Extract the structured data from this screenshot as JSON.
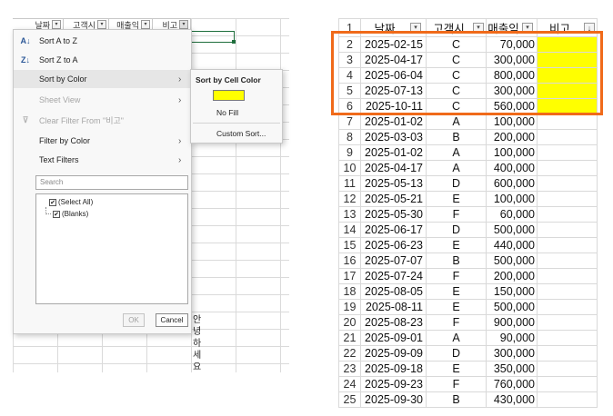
{
  "left_panel": {
    "headers": [
      {
        "label": "날짜",
        "active": false
      },
      {
        "label": "고객시",
        "active": false
      },
      {
        "label": "매출익",
        "active": false
      },
      {
        "label": "비고",
        "active": true
      }
    ],
    "filter_menu": {
      "items": [
        {
          "label": "Sort A to Z",
          "icon": "sort-az-icon",
          "enabled": true,
          "has_submenu": false
        },
        {
          "label": "Sort Z to A",
          "icon": "sort-za-icon",
          "enabled": true,
          "has_submenu": false
        },
        {
          "label": "Sort by Color",
          "icon": "",
          "enabled": true,
          "has_submenu": true,
          "highlighted": true
        },
        {
          "label": "Sheet View",
          "icon": "",
          "enabled": false,
          "has_submenu": true
        },
        {
          "label": "Clear Filter From \"비고\"",
          "icon": "clear-filter-icon",
          "enabled": false,
          "has_submenu": false
        },
        {
          "label": "Filter by Color",
          "icon": "",
          "enabled": true,
          "has_submenu": true
        },
        {
          "label": "Text Filters",
          "icon": "",
          "enabled": true,
          "has_submenu": true
        }
      ],
      "search_placeholder": "Search",
      "checklist": [
        {
          "label": "(Select All)",
          "checked": true
        },
        {
          "label": "(Blanks)",
          "checked": true
        }
      ],
      "ok_label": "OK",
      "cancel_label": "Cancel"
    },
    "submenu": {
      "title": "Sort by Cell Color",
      "swatch_color": "#FFFF00",
      "no_fill_label": "No Fill",
      "custom_sort_label": "Custom Sort..."
    },
    "vertical_text": [
      "안",
      "녕",
      "하",
      "세",
      "요"
    ]
  },
  "right_panel": {
    "header_row_number": "1",
    "headers": [
      "날짜",
      "고객시",
      "매출익",
      "비고"
    ],
    "rows": [
      {
        "n": "2",
        "date": "2025-02-15",
        "cust": "C",
        "sales": "70,000",
        "yellow": true
      },
      {
        "n": "3",
        "date": "2025-04-17",
        "cust": "C",
        "sales": "300,000",
        "yellow": true
      },
      {
        "n": "4",
        "date": "2025-06-04",
        "cust": "C",
        "sales": "800,000",
        "yellow": true
      },
      {
        "n": "5",
        "date": "2025-07-13",
        "cust": "C",
        "sales": "300,000",
        "yellow": true
      },
      {
        "n": "6",
        "date": "2025-10-11",
        "cust": "C",
        "sales": "560,000",
        "yellow": true
      },
      {
        "n": "7",
        "date": "2025-01-02",
        "cust": "A",
        "sales": "100,000",
        "yellow": false
      },
      {
        "n": "8",
        "date": "2025-03-03",
        "cust": "B",
        "sales": "200,000",
        "yellow": false
      },
      {
        "n": "9",
        "date": "2025-01-02",
        "cust": "A",
        "sales": "100,000",
        "yellow": false
      },
      {
        "n": "10",
        "date": "2025-04-17",
        "cust": "A",
        "sales": "400,000",
        "yellow": false
      },
      {
        "n": "11",
        "date": "2025-05-13",
        "cust": "D",
        "sales": "600,000",
        "yellow": false
      },
      {
        "n": "12",
        "date": "2025-05-21",
        "cust": "E",
        "sales": "100,000",
        "yellow": false
      },
      {
        "n": "13",
        "date": "2025-05-30",
        "cust": "F",
        "sales": "60,000",
        "yellow": false
      },
      {
        "n": "14",
        "date": "2025-06-17",
        "cust": "D",
        "sales": "500,000",
        "yellow": false
      },
      {
        "n": "15",
        "date": "2025-06-23",
        "cust": "E",
        "sales": "440,000",
        "yellow": false
      },
      {
        "n": "16",
        "date": "2025-07-07",
        "cust": "B",
        "sales": "500,000",
        "yellow": false
      },
      {
        "n": "17",
        "date": "2025-07-24",
        "cust": "F",
        "sales": "200,000",
        "yellow": false
      },
      {
        "n": "18",
        "date": "2025-08-05",
        "cust": "E",
        "sales": "150,000",
        "yellow": false
      },
      {
        "n": "19",
        "date": "2025-08-11",
        "cust": "E",
        "sales": "500,000",
        "yellow": false
      },
      {
        "n": "20",
        "date": "2025-08-23",
        "cust": "F",
        "sales": "900,000",
        "yellow": false
      },
      {
        "n": "21",
        "date": "2025-09-01",
        "cust": "A",
        "sales": "90,000",
        "yellow": false
      },
      {
        "n": "22",
        "date": "2025-09-09",
        "cust": "D",
        "sales": "300,000",
        "yellow": false
      },
      {
        "n": "23",
        "date": "2025-09-18",
        "cust": "E",
        "sales": "350,000",
        "yellow": false
      },
      {
        "n": "24",
        "date": "2025-09-23",
        "cust": "F",
        "sales": "760,000",
        "yellow": false
      },
      {
        "n": "25",
        "date": "2025-09-30",
        "cust": "B",
        "sales": "430,000",
        "yellow": false
      }
    ],
    "highlight_color": "#F06A1A",
    "fill_color": "#FFFF00"
  }
}
